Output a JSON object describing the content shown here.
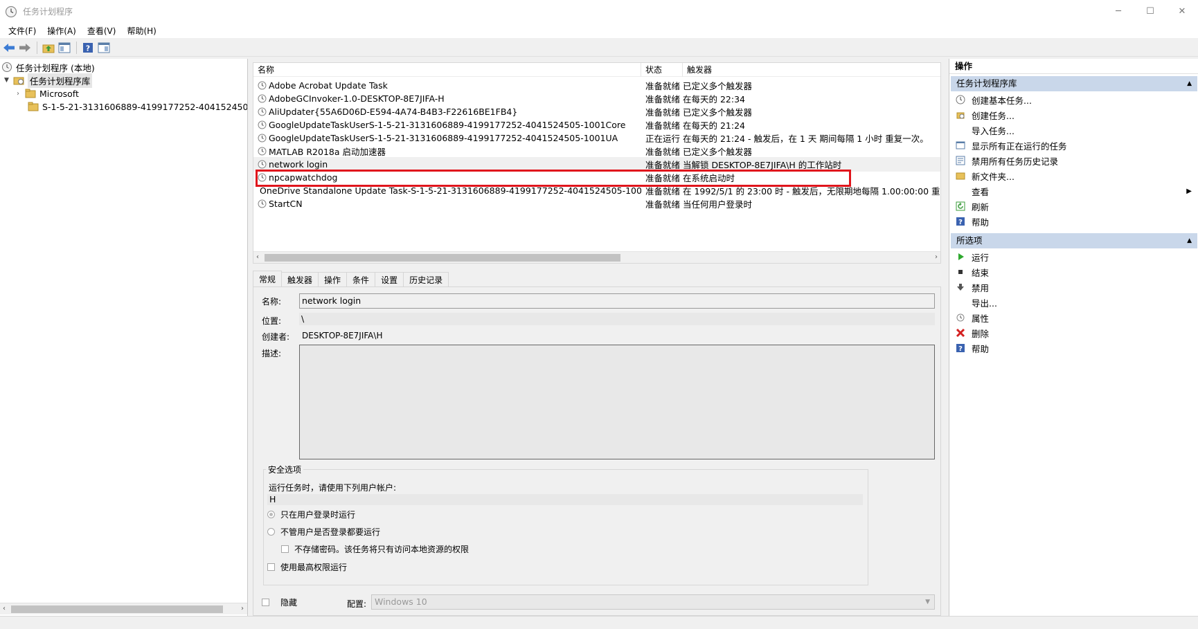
{
  "window": {
    "title": "任务计划程序",
    "minimize": "─",
    "maximize": "☐",
    "close": "✕"
  },
  "menu": [
    "文件(F)",
    "操作(A)",
    "查看(V)",
    "帮助(H)"
  ],
  "tree": {
    "root": "任务计划程序 (本地)",
    "library": "任务计划程序库",
    "children": [
      "Microsoft",
      "S-1-5-21-3131606889-4199177252-4041524505-10"
    ]
  },
  "task_list": {
    "columns": [
      "名称",
      "状态",
      "触发器"
    ],
    "rows": [
      {
        "name": "Adobe Acrobat Update Task",
        "status": "准备就绪",
        "trigger": "已定义多个触发器"
      },
      {
        "name": "AdobeGCInvoker-1.0-DESKTOP-8E7JIFA-H",
        "status": "准备就绪",
        "trigger": "在每天的 22:34"
      },
      {
        "name": "AliUpdater{55A6D06D-E594-4A74-B4B3-F22616BE1FB4}",
        "status": "准备就绪",
        "trigger": "已定义多个触发器"
      },
      {
        "name": "GoogleUpdateTaskUserS-1-5-21-3131606889-4199177252-4041524505-1001Core",
        "status": "准备就绪",
        "trigger": "在每天的 21:24"
      },
      {
        "name": "GoogleUpdateTaskUserS-1-5-21-3131606889-4199177252-4041524505-1001UA",
        "status": "正在运行",
        "trigger": "在每天的 21:24 - 触发后，在 1 天 期间每隔 1 小时 重复一次。"
      },
      {
        "name": "MATLAB R2018a 启动加速器",
        "status": "准备就绪",
        "trigger": "已定义多个触发器"
      },
      {
        "name": "network login",
        "status": "准备就绪",
        "trigger": "当解锁 DESKTOP-8E7JIFA\\H 的工作站时"
      },
      {
        "name": "npcapwatchdog",
        "status": "准备就绪",
        "trigger": "在系统启动时"
      },
      {
        "name": "OneDrive Standalone Update Task-S-1-5-21-3131606889-4199177252-4041524505-1001",
        "status": "准备就绪",
        "trigger": "在 1992/5/1 的 23:00 时 - 触发后，无限期地每隔 1.00:00:00 重复一次"
      },
      {
        "name": "StartCN",
        "status": "准备就绪",
        "trigger": "当任何用户登录时"
      }
    ]
  },
  "details": {
    "tabs": [
      "常规",
      "触发器",
      "操作",
      "条件",
      "设置",
      "历史记录"
    ],
    "name_label": "名称:",
    "name_value": "network login",
    "location_label": "位置:",
    "location_value": "\\",
    "author_label": "创建者:",
    "author_value": "DESKTOP-8E7JIFA\\H",
    "desc_label": "描述:",
    "security_legend": "安全选项",
    "run_as_label": "运行任务时，请使用下列用户帐户:",
    "run_as_value": "H",
    "opt_logged_on": "只在用户登录时运行",
    "opt_always": "不管用户是否登录都要运行",
    "opt_no_password": "不存储密码。该任务将只有访问本地资源的权限",
    "opt_highest": "使用最高权限运行",
    "hidden_label": "隐藏",
    "config_label": "配置:",
    "config_value": "Windows 10"
  },
  "actions": {
    "title": "操作",
    "section1": "任务计划程序库",
    "items1": [
      "创建基本任务...",
      "创建任务...",
      "导入任务...",
      "显示所有正在运行的任务",
      "禁用所有任务历史记录",
      "新文件夹...",
      "查看",
      "刷新",
      "帮助"
    ],
    "section2": "所选项",
    "items2": [
      "运行",
      "结束",
      "禁用",
      "导出...",
      "属性",
      "删除",
      "帮助"
    ]
  },
  "colors": {
    "highlight": "#e0151c",
    "section_header": "#c9d7ea",
    "run_green": "#2ea82e",
    "delete_red": "#d42020"
  }
}
